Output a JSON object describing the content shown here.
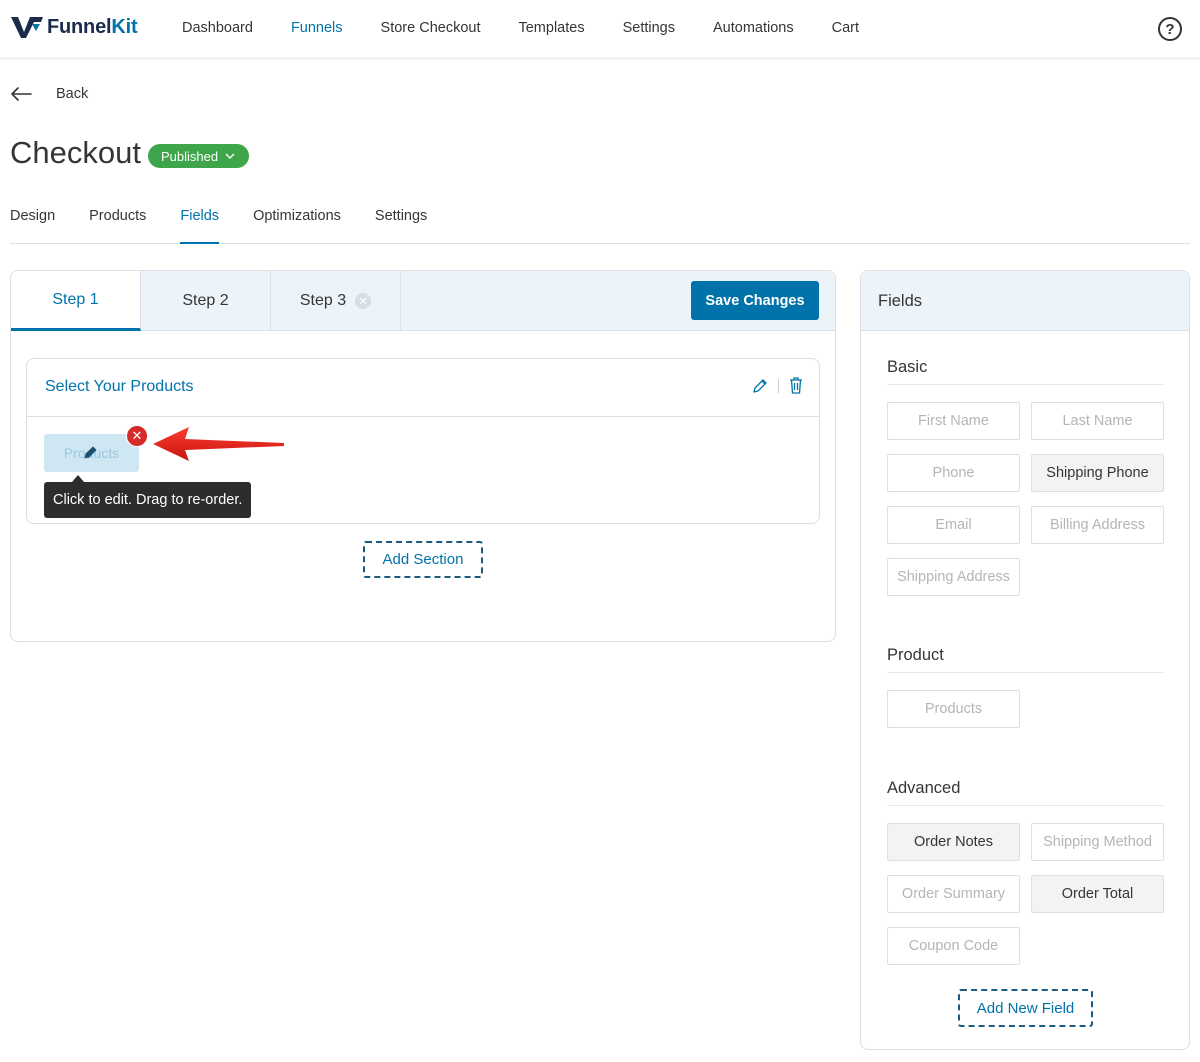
{
  "brand": {
    "name_part1": "Funnel",
    "name_part2": "Kit"
  },
  "nav": [
    {
      "label": "Dashboard"
    },
    {
      "label": "Funnels",
      "active": true
    },
    {
      "label": "Store Checkout"
    },
    {
      "label": "Templates"
    },
    {
      "label": "Settings"
    },
    {
      "label": "Automations"
    },
    {
      "label": "Cart"
    }
  ],
  "help_label": "?",
  "back_label": "Back",
  "page": {
    "title": "Checkout",
    "status": "Published"
  },
  "tabs": [
    {
      "label": "Design"
    },
    {
      "label": "Products"
    },
    {
      "label": "Fields",
      "active": true
    },
    {
      "label": "Optimizations"
    },
    {
      "label": "Settings"
    }
  ],
  "steps": [
    {
      "label": "Step 1",
      "active": true
    },
    {
      "label": "Step 2"
    },
    {
      "label": "Step 3",
      "closable": true
    }
  ],
  "save_label": "Save Changes",
  "section": {
    "title": "Select Your Products",
    "field_chip": "Products",
    "tooltip": "Click to edit. Drag to re-order."
  },
  "add_section_label": "Add Section",
  "fields_panel": {
    "title": "Fields",
    "groups": {
      "basic": {
        "title": "Basic",
        "items": [
          {
            "label": "First Name",
            "used": false
          },
          {
            "label": "Last Name",
            "used": false
          },
          {
            "label": "Phone",
            "used": false
          },
          {
            "label": "Shipping Phone",
            "used": true
          },
          {
            "label": "Email",
            "used": false
          },
          {
            "label": "Billing Address",
            "used": false
          },
          {
            "label": "Shipping Address",
            "used": false
          }
        ]
      },
      "product": {
        "title": "Product",
        "items": [
          {
            "label": "Products",
            "used": false
          }
        ]
      },
      "advanced": {
        "title": "Advanced",
        "items": [
          {
            "label": "Order Notes",
            "used": true
          },
          {
            "label": "Shipping Method",
            "used": false
          },
          {
            "label": "Order Summary",
            "used": false
          },
          {
            "label": "Order Total",
            "used": true
          },
          {
            "label": "Coupon Code",
            "used": false
          }
        ]
      }
    },
    "add_new_label": "Add New Field"
  },
  "colors": {
    "primary": "#0073aa",
    "published": "#3fa54a",
    "danger": "#d62b2b",
    "panel_header": "#edf4f9"
  }
}
